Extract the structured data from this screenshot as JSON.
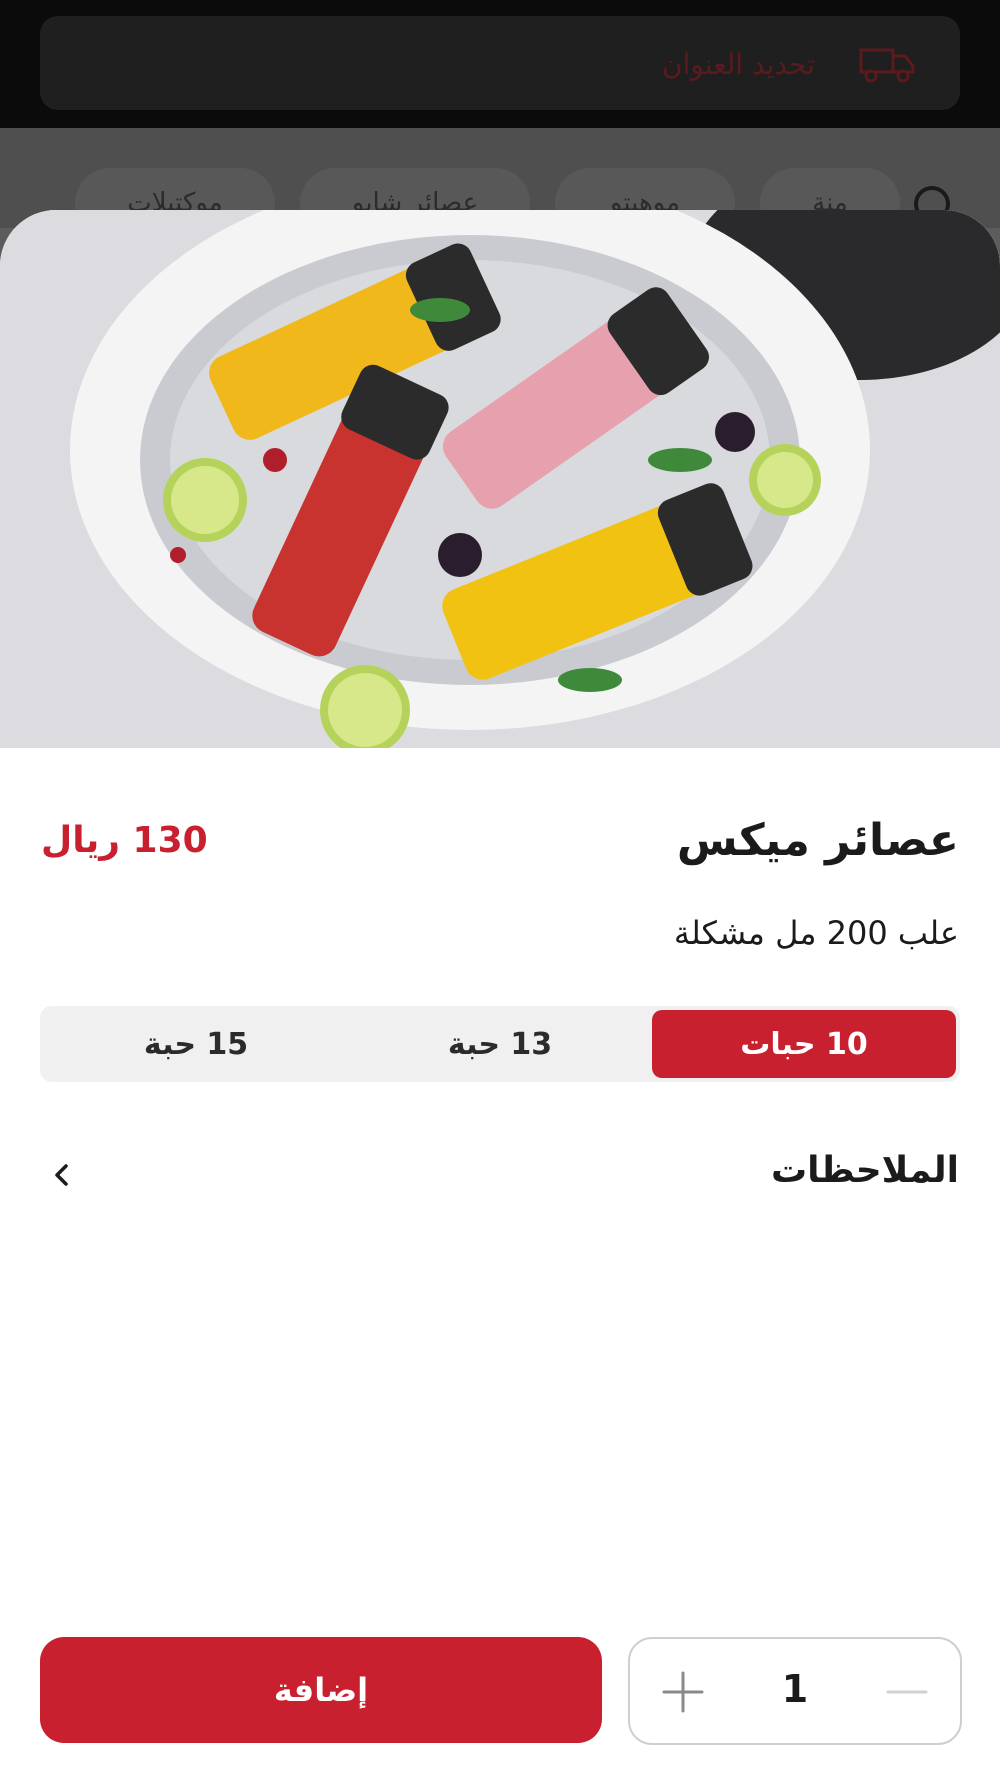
{
  "header": {
    "address_label": "تحديد العنوان",
    "delivery_icon": "truck-icon"
  },
  "background": {
    "chips": [
      "منة",
      "موهيتو",
      "عصائر شابو",
      "موكتيلات"
    ],
    "search_icon": "search-icon"
  },
  "product": {
    "title": "عصائر ميكس",
    "price": "130 ريال",
    "description": "علب 200 مل مشكلة",
    "sizes": [
      {
        "label": "10 حبات",
        "selected": true
      },
      {
        "label": "13 حبة",
        "selected": false
      },
      {
        "label": "15 حبة",
        "selected": false
      }
    ],
    "notes_label": "الملاحظات"
  },
  "footer": {
    "add_label": "إضافة",
    "quantity": "1"
  },
  "colors": {
    "accent": "#c8202f",
    "text": "#1b1b1b",
    "segment_bg": "#f0f0f0"
  }
}
